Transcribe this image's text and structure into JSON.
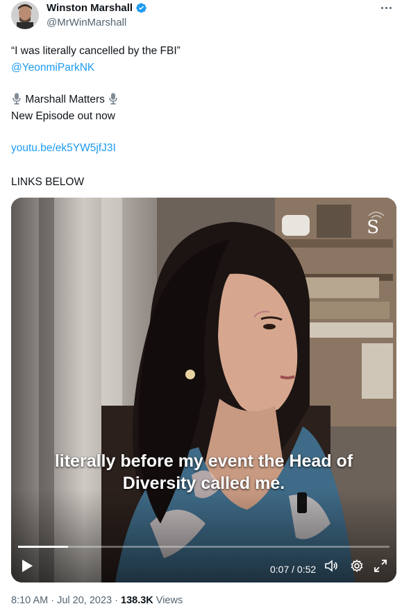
{
  "author": {
    "name": "Winston Marshall",
    "handle": "@MrWinMarshall"
  },
  "tweet": {
    "line1": "“I was literally cancelled by the FBI”",
    "mention": "@YeonmiParkNK",
    "show_name": "Marshall Matters",
    "line3": "New Episode out now",
    "link": "youtu.be/ek5YW5jfJ3I",
    "line5": "LINKS BELOW"
  },
  "video": {
    "subtitle_line1": "literally before my event the Head of",
    "subtitle_line2": "Diversity called me.",
    "watermark": "S",
    "time": "0:07 / 0:52",
    "progress": 0.135
  },
  "footer": {
    "time": "8:10 AM",
    "date": "Jul 20, 2023",
    "sep": " · ",
    "views_count": "138.3K",
    "views_label": "Views"
  },
  "colors": {
    "link": "#1d9bf0",
    "verified": "#1d9bf0",
    "muted": "#536471"
  }
}
